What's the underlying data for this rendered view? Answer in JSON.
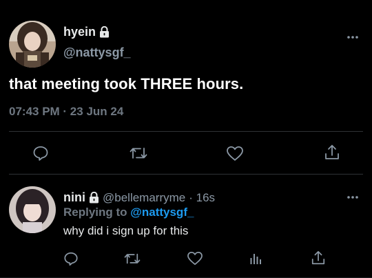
{
  "main_tweet": {
    "display_name": "hyein",
    "handle": "@nattysgf_",
    "text": "that meeting took THREE hours.",
    "timestamp": "07:43 PM · 23 Jun 24",
    "protected_icon": "lock-icon",
    "more_icon": "more-horizontal-icon",
    "actions": [
      "reply-icon",
      "retweet-icon",
      "like-icon",
      "share-icon"
    ]
  },
  "reply": {
    "display_name": "nini",
    "handle": "@bellemarryme",
    "time": "· 16s",
    "replying_prefix": "Replying to ",
    "replying_to": "@nattysgf_",
    "text": "why did i sign up for this",
    "protected_icon": "lock-icon",
    "more_icon": "more-horizontal-icon",
    "actions": [
      "reply-icon",
      "retweet-icon",
      "like-icon",
      "analytics-icon",
      "share-icon"
    ]
  },
  "colors": {
    "background": "#000000",
    "primary_text": "#e7e9ea",
    "secondary_text": "#8b98a5",
    "muted_text": "#6e7781",
    "link": "#1d9bf0",
    "divider": "#2f3336"
  }
}
